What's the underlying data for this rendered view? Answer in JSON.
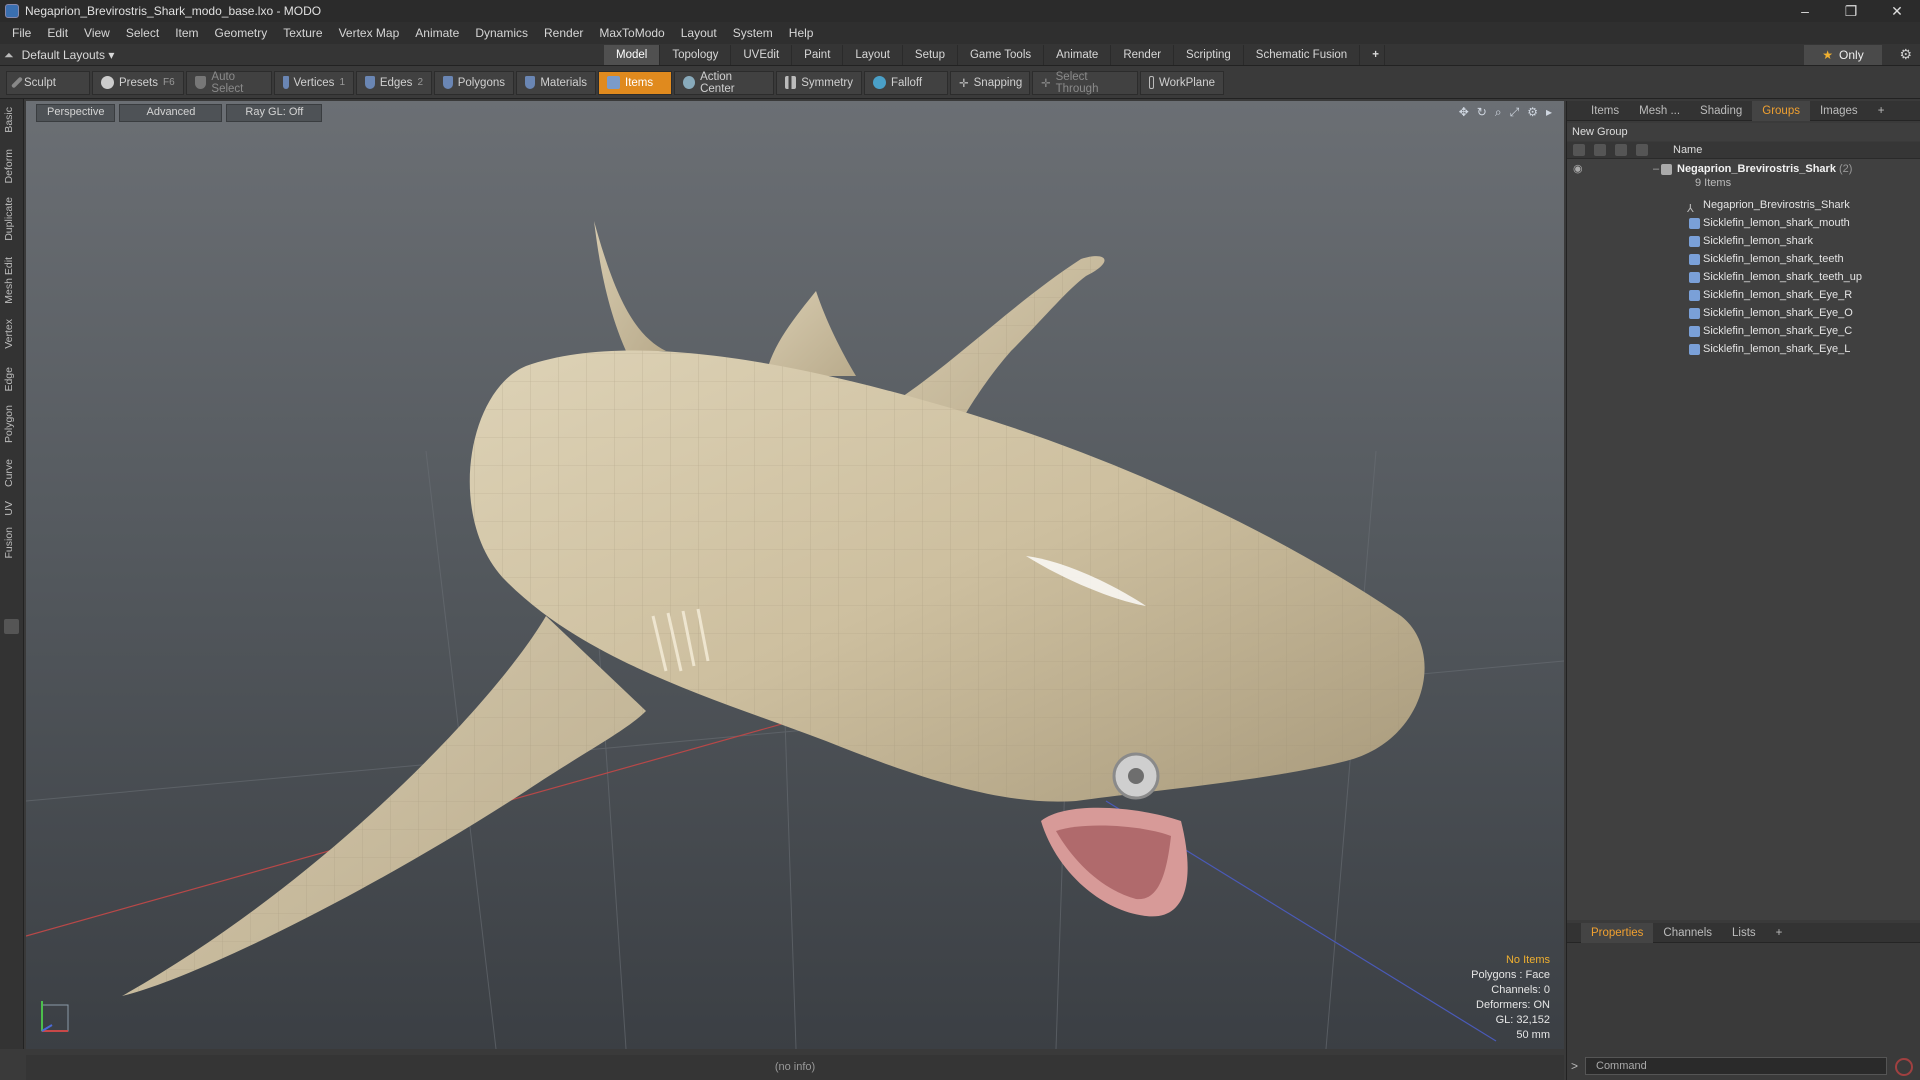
{
  "window": {
    "title": "Negaprion_Brevirostris_Shark_modo_base.lxo - MODO",
    "controls": [
      "–",
      "❐",
      "✕"
    ]
  },
  "menu": [
    "File",
    "Edit",
    "View",
    "Select",
    "Item",
    "Geometry",
    "Texture",
    "Vertex Map",
    "Animate",
    "Dynamics",
    "Render",
    "MaxToModo",
    "Layout",
    "System",
    "Help"
  ],
  "layout": {
    "selector": "Default Layouts ▾",
    "tabs": [
      "Model",
      "Topology",
      "UVEdit",
      "Paint",
      "Layout",
      "Setup",
      "Game Tools",
      "Animate",
      "Render",
      "Scripting",
      "Schematic Fusion"
    ],
    "active_tab": "Model",
    "add": "+",
    "only": "Only"
  },
  "toolbar": {
    "sculpt": "Sculpt",
    "presets": "Presets",
    "presets_key": "F6",
    "auto_select": "Auto Select",
    "vertices": "Vertices",
    "vertices_key": "1",
    "edges": "Edges",
    "edges_key": "2",
    "polygons": "Polygons",
    "materials": "Materials",
    "items": "Items",
    "action_center": "Action Center",
    "symmetry": "Symmetry",
    "falloff": "Falloff",
    "snapping": "Snapping",
    "select_through": "Select Through",
    "workplane": "WorkPlane"
  },
  "left_tabs": [
    "Basic",
    "Deform",
    "Duplicate",
    "Mesh Edit",
    "Vertex",
    "Edge",
    "Polygon",
    "Curve",
    "UV",
    "Fusion"
  ],
  "viewport": {
    "view": "Perspective",
    "shading": "Advanced",
    "raygl": "Ray GL: Off",
    "info": {
      "no_items": "No Items",
      "polygons": "Polygons : Face",
      "channels": "Channels: 0",
      "deformers": "Deformers: ON",
      "gl": "GL: 32,152",
      "focal": "50 mm"
    }
  },
  "status": "(no info)",
  "panel": {
    "tabs": [
      "Items",
      "Mesh ...",
      "Shading",
      "Groups",
      "Images"
    ],
    "active_tab": "Groups",
    "add": "+",
    "new_group": "New Group",
    "name_header": "Name",
    "group": {
      "name": "Negaprion_Brevirostris_Shark",
      "count": "(2)",
      "items_count": "9 Items"
    },
    "items": [
      "Negaprion_Brevirostris_Shark",
      "Sicklefin_lemon_shark_mouth",
      "Sicklefin_lemon_shark",
      "Sicklefin_lemon_shark_teeth",
      "Sicklefin_lemon_shark_teeth_up",
      "Sicklefin_lemon_shark_Eye_R",
      "Sicklefin_lemon_shark_Eye_O",
      "Sicklefin_lemon_shark_Eye_C",
      "Sicklefin_lemon_shark_Eye_L"
    ],
    "bottom_tabs": [
      "Properties",
      "Channels",
      "Lists"
    ],
    "bottom_active": "Properties",
    "command_placeholder": "Command"
  }
}
